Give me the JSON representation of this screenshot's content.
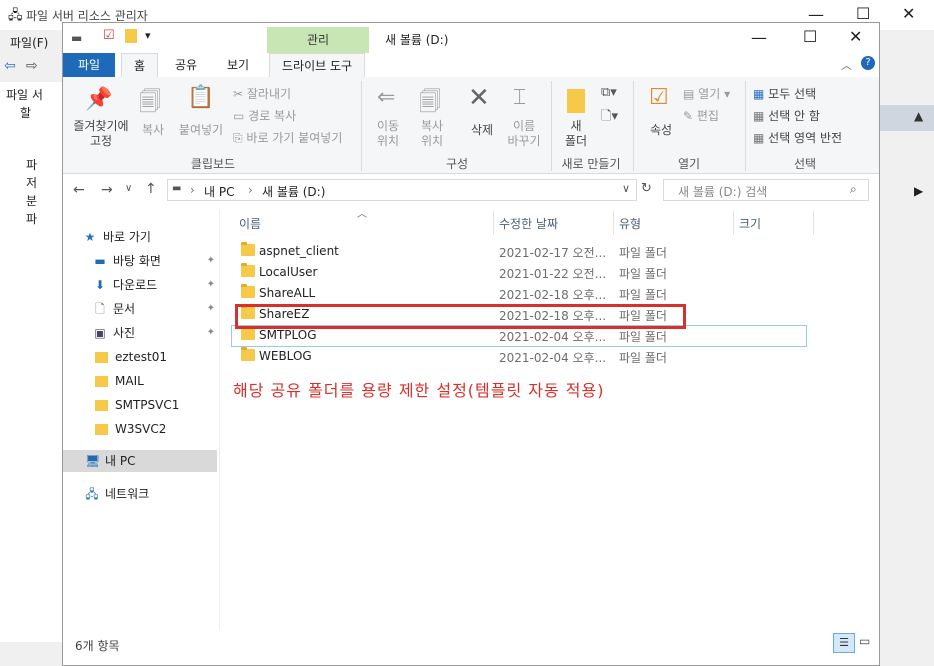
{
  "background_window": {
    "title": "파일 서버 리소스 관리자",
    "menu_file": "파일(F)",
    "tree_items": [
      "파일 서",
      "할",
      "파",
      "저",
      "분",
      "파"
    ]
  },
  "explorer": {
    "manage_tab": "관리",
    "title": "새 볼륨 (D:)",
    "tabs": {
      "file": "파일",
      "home": "홈",
      "share": "공유",
      "view": "보기",
      "drive_tools": "드라이브 도구"
    },
    "ribbon": {
      "pin_quick": "즐겨찾기에\n고정",
      "copy": "복사",
      "paste": "붙여넣기",
      "cut": "잘라내기",
      "copy_path": "경로 복사",
      "paste_shortcut": "바로 가기 붙여넣기",
      "move_to": "이동\n위치",
      "copy_to": "복사\n위치",
      "delete": "삭제",
      "rename": "이름\n바꾸기",
      "new_folder": "새\n폴더",
      "properties": "속성",
      "open": "열기",
      "edit": "편집",
      "select_all": "모두 선택",
      "select_none": "선택 안 함",
      "invert_selection": "선택 영역 반전",
      "groups": {
        "clipboard": "클립보드",
        "organize": "구성",
        "new": "새로 만들기",
        "open": "열기",
        "select": "선택"
      }
    },
    "address": {
      "pc": "내 PC",
      "volume": "새 볼륨 (D:)"
    },
    "search_placeholder": "새 볼륨 (D:) 검색",
    "nav": {
      "quick_access": "바로 가기",
      "desktop": "바탕 화면",
      "downloads": "다운로드",
      "documents": "문서",
      "pictures": "사진",
      "folders": [
        "eztest01",
        "MAIL",
        "SMTPSVC1",
        "W3SVC2"
      ],
      "this_pc": "내 PC",
      "network": "네트워크"
    },
    "columns": {
      "name": "이름",
      "modified": "수정한 날짜",
      "type": "유형",
      "size": "크기"
    },
    "files": [
      {
        "name": "aspnet_client",
        "date": "2021-02-17 오전...",
        "type": "파일 폴더"
      },
      {
        "name": "LocalUser",
        "date": "2021-01-22 오전...",
        "type": "파일 폴더"
      },
      {
        "name": "ShareALL",
        "date": "2021-02-18 오후...",
        "type": "파일 폴더"
      },
      {
        "name": "ShareEZ",
        "date": "2021-02-18 오후...",
        "type": "파일 폴더"
      },
      {
        "name": "SMTPLOG",
        "date": "2021-02-04 오후...",
        "type": "파일 폴더"
      },
      {
        "name": "WEBLOG",
        "date": "2021-02-04 오후...",
        "type": "파일 폴더"
      }
    ],
    "annotation": "해당 공유 폴더를 용량 제한 설정(템플릿 자동 적용)",
    "status": "6개 항목"
  }
}
